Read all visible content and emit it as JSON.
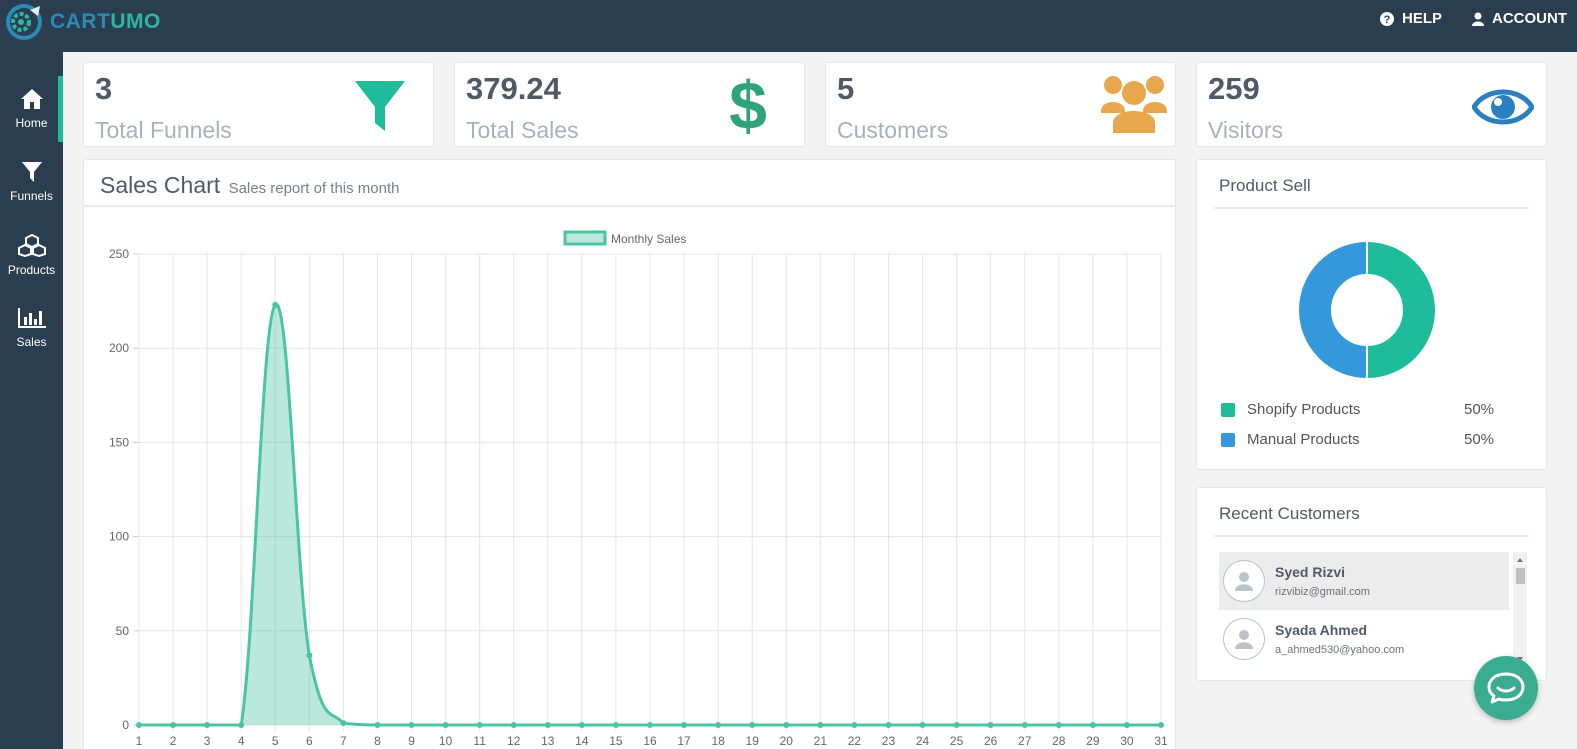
{
  "header": {
    "brand_prefix": "CART",
    "brand_suffix": "UMO",
    "help_label": "HELP",
    "account_label": "ACCOUNT"
  },
  "sidebar": {
    "items": [
      {
        "label": "Home",
        "icon": "home-icon",
        "active": true
      },
      {
        "label": "Funnels",
        "icon": "funnel-icon",
        "active": false
      },
      {
        "label": "Products",
        "icon": "cubes-icon",
        "active": false
      },
      {
        "label": "Sales",
        "icon": "bar-chart-icon",
        "active": false
      }
    ]
  },
  "stats": [
    {
      "value": "3",
      "label": "Total Funnels",
      "icon": "funnel-icon",
      "color": "#1fbc9c"
    },
    {
      "value": "379.24",
      "label": "Total Sales",
      "icon": "dollar-icon",
      "color": "#2fa37b"
    },
    {
      "value": "5",
      "label": "Customers",
      "icon": "users-icon",
      "color": "#e8a74d"
    },
    {
      "value": "259",
      "label": "Visitors",
      "icon": "eye-icon",
      "color": "#2a7fbf"
    }
  ],
  "sales_chart": {
    "title": "Sales Chart",
    "subtitle": "Sales report of this month"
  },
  "chart_data": {
    "type": "area",
    "legend": "Monthly Sales",
    "legend_position": "top",
    "x": [
      1,
      2,
      3,
      4,
      5,
      6,
      7,
      8,
      9,
      10,
      11,
      12,
      13,
      14,
      15,
      16,
      17,
      18,
      19,
      20,
      21,
      22,
      23,
      24,
      25,
      26,
      27,
      28,
      29,
      30,
      31
    ],
    "series": [
      {
        "name": "Monthly Sales",
        "values": [
          0,
          0,
          0,
          0,
          223,
          37,
          1,
          0,
          0,
          0,
          0,
          0,
          0,
          0,
          0,
          0,
          0,
          0,
          0,
          0,
          0,
          0,
          0,
          0,
          0,
          0,
          0,
          0,
          0,
          0,
          0
        ],
        "color": "#4cc3a4"
      }
    ],
    "ylim": [
      0,
      250
    ],
    "yticks": [
      0,
      50,
      100,
      150,
      200,
      250
    ],
    "grid": true
  },
  "product_sell": {
    "title": "Product Sell",
    "items": [
      {
        "label": "Shopify Products",
        "pct": "50%",
        "value": 50,
        "color": "#1fbc9c"
      },
      {
        "label": "Manual Products",
        "pct": "50%",
        "value": 50,
        "color": "#3498db"
      }
    ]
  },
  "recent_customers": {
    "title": "Recent Customers",
    "items": [
      {
        "name": "Syed Rizvi",
        "email": "rizvibiz@gmail.com"
      },
      {
        "name": "Syada Ahmed",
        "email": "a_ahmed530@yahoo.com"
      }
    ]
  }
}
